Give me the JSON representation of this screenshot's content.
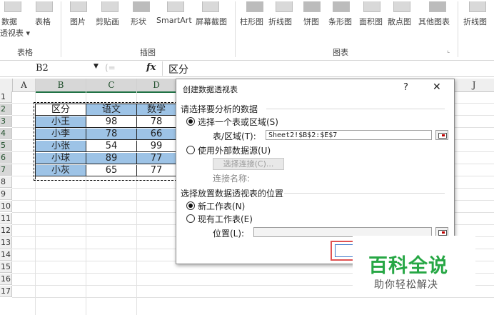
{
  "ribbon": {
    "items": [
      {
        "label": "数据",
        "sub": "透视表 ▾"
      },
      {
        "label": "表格"
      },
      {
        "label": "图片"
      },
      {
        "label": "剪贴画"
      },
      {
        "label": "形状"
      },
      {
        "label": "SmartArt"
      },
      {
        "label": "屏幕截图"
      },
      {
        "label": "柱形图"
      },
      {
        "label": "折线图"
      },
      {
        "label": "饼图"
      },
      {
        "label": "条形图"
      },
      {
        "label": "面积图"
      },
      {
        "label": "散点图"
      },
      {
        "label": "其他图表"
      },
      {
        "label": "折线图"
      }
    ],
    "groups": {
      "tables": "表格",
      "illustrations": "插图",
      "charts": "图表"
    }
  },
  "formula_bar": {
    "name_box": "B2",
    "fx": "fx",
    "content": "区分"
  },
  "columns": [
    "A",
    "B",
    "C",
    "D",
    "J"
  ],
  "rows": [
    "1",
    "2",
    "3",
    "4",
    "5",
    "6",
    "7",
    "8",
    "9",
    "10",
    "11",
    "12",
    "13",
    "14",
    "15",
    "16",
    "17"
  ],
  "table": {
    "headers": [
      "区分",
      "语文",
      "数学"
    ],
    "rows": [
      [
        "小王",
        "98",
        "78"
      ],
      [
        "小李",
        "78",
        "66"
      ],
      [
        "小张",
        "54",
        "99"
      ],
      [
        "小球",
        "89",
        "77"
      ],
      [
        "小灰",
        "65",
        "77"
      ]
    ]
  },
  "dialog": {
    "title": "创建数据透视表",
    "help": "?",
    "close": "✕",
    "section1": "请选择要分析的数据",
    "opt_table": "选择一个表或区域(S)",
    "range_label": "表/区域(T):",
    "range_value": "Sheet2!$B$2:$E$7",
    "opt_external": "使用外部数据源(U)",
    "choose_conn": "选择连接(C)...",
    "conn_name": "连接名称:",
    "section2": "选择放置数据透视表的位置",
    "opt_new": "新工作表(N)",
    "opt_existing": "现有工作表(E)",
    "location_label": "位置(L):",
    "location_value": ""
  },
  "watermark": {
    "title": "百科全说",
    "subtitle": "助你轻松解决",
    "title_color": "#27a745"
  }
}
